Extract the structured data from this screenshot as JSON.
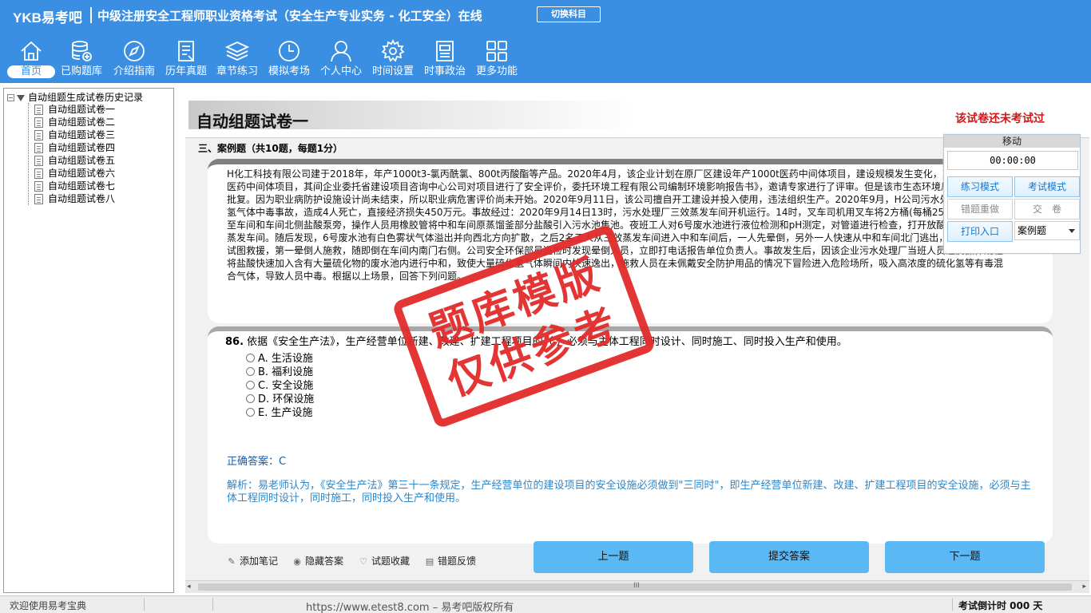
{
  "header": {
    "logo": "YKB易考吧",
    "title": "中级注册安全工程师职业资格考试（安全生产专业实务 - 化工安全）在线",
    "switch_subject": "切换科目",
    "nav": [
      {
        "label": "首页",
        "icon": "home-icon"
      },
      {
        "label": "已购题库",
        "icon": "database-icon"
      },
      {
        "label": "介绍指南",
        "icon": "compass-icon"
      },
      {
        "label": "历年真题",
        "icon": "document-list-icon"
      },
      {
        "label": "章节练习",
        "icon": "layers-icon"
      },
      {
        "label": "模拟考场",
        "icon": "clock-icon"
      },
      {
        "label": "个人中心",
        "icon": "user-icon"
      },
      {
        "label": "时间设置",
        "icon": "gear-icon"
      },
      {
        "label": "时事政治",
        "icon": "news-icon"
      },
      {
        "label": "更多功能",
        "icon": "grid-icon"
      }
    ]
  },
  "tree": {
    "root": "自动组题生成试卷历史记录",
    "items": [
      "自动组题试卷一",
      "自动组题试卷二",
      "自动组题试卷三",
      "自动组题试卷四",
      "自动组题试卷五",
      "自动组题试卷六",
      "自动组题试卷七",
      "自动组题试卷八"
    ]
  },
  "main": {
    "paper_title": "自动组题试卷一",
    "exam_status": "该试卷还未考试过",
    "section_title": "三、案例题（共10题，每题1分）",
    "case_text": "H化工科技有限公司建于2018年，年产1000t3-氯丙酰氯、800t丙酸酯等产品。2020年4月，该企业计划在原厂区建设年产1000t医药中间体项目，建设规模发生变化，变更为1500t医药中间体项目，其间企业委托省建设项目咨询中心公司对项目进行了安全评价，委托环境工程有限公司编制环境影响报告书》，邀请专家进行了评审。但是该市生态环境局目前尚未下发批复。因为职业病防护设施设计尚未结束，所以职业病危害评价尚未开始。2020年9月11日，该公司擅自开工建设并投入使用，违法组织生产。2020年9月，H公司污水处理厂发生硫化氢气体中毒事故，造成4人死亡，直接经济损失450万元。事故经过：2020年9月14日13时，污水处理厂三效蒸发车间开机运行。14时，叉车司机用叉车将2方桶(每桶250kg)盐酸运送至车间和车间北侧盐酸泵旁，操作人员用橡胶管将中和车间原蒸馏釜部分盐酸引入污水池集池。夜班工人对6号废水池进行液位检测和pH测定，对管道进行检查，打开放酸阀后返回三效蒸发车间。随后发现，6号废水池有白色雾状气体溢出并向西北方向扩散，之后2名工人从三效蒸发车间进入中和车间后，一人先晕倒，另外一人快速从中和车间北门逃出，二人进入车间试图救援，第一晕倒人施救，随即倒在车间内南门右侧。公司安全环保部员巡检时发现晕倒人员，立即打电话报告单位负责人。事故发生后，因该企业污水处理厂当班人员违反操作规程将盐酸快速加入含有大量硫化物的废水池内进行中和，致使大量硫化氢气体瞬间内快速逸出，施救人员在未佩戴安全防护用品的情况下冒险进入危险场所，吸入高浓度的硫化氢等有毒混合气体，导致人员中毒。根据以上场景，回答下列问题。",
    "question": {
      "number": "86.",
      "stem": "依据《安全生产法》，生产经营单位新建、改建、扩建工程项目的（ ）必须与主体工程同时设计、同时施工、同时投入生产和使用。",
      "options": [
        "A. 生活设施",
        "B. 福利设施",
        "C. 安全设施",
        "D. 环保设施",
        "E. 生产设施"
      ]
    },
    "answer_label": "正确答案：",
    "answer_value": "C",
    "analysis": "解析：易老师认为，《安全生产法》第三十一条规定，生产经营单位的建设项目的安全设施必须做到\"三同时\"，即生产经营单位新建、改建、扩建工程项目的安全设施，必须与主体工程同时设计，同时施工，同时投入生产和使用。",
    "tools": [
      {
        "label": "添加笔记",
        "icon": "pencil-icon"
      },
      {
        "label": "隐藏答案",
        "icon": "eye-icon"
      },
      {
        "label": "试题收藏",
        "icon": "heart-icon"
      },
      {
        "label": "错题反馈",
        "icon": "feedback-icon"
      }
    ],
    "prev_button": "上一题",
    "submit_button": "提交答案",
    "next_button": "下一题"
  },
  "float_panel": {
    "handle": "移动",
    "timer": "00:00:00",
    "practice_mode": "练习模式",
    "exam_mode": "考试模式",
    "redo_wrong": "错题重做",
    "submit_paper": "交　卷",
    "print_entry": "打印入口",
    "type_select": "案例题"
  },
  "watermark": {
    "line1": "题库模版",
    "line2": "仅供参考"
  },
  "status": {
    "welcome": "欢迎使用易考宝典",
    "url": "https://www.etest8.com – 易考吧版权所有",
    "countdown": "考试倒计时 000 天"
  },
  "colors": {
    "brand_blue": "#3a8fe3",
    "button_blue": "#5ab8f5",
    "status_red": "#d01818",
    "stamp_red": "#e32b2b"
  }
}
